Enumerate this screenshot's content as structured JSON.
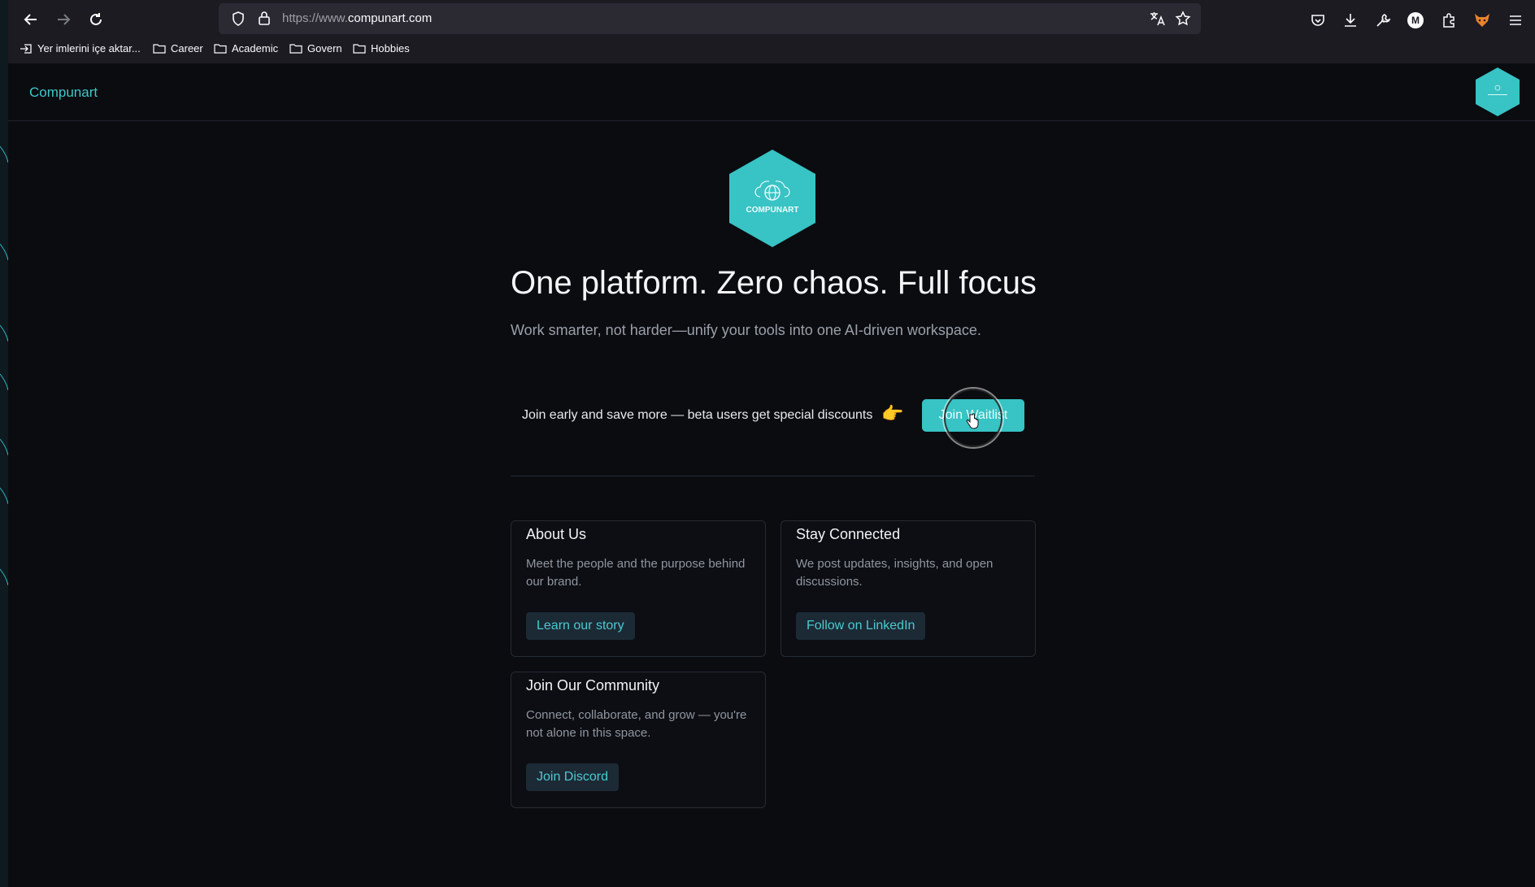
{
  "browser": {
    "url_prefix": "https://www.",
    "url_domain": "compunart.com",
    "bookmarks": [
      {
        "label": "Yer imlerini içe aktar..."
      },
      {
        "label": "Career"
      },
      {
        "label": "Academic"
      },
      {
        "label": "Govern"
      },
      {
        "label": "Hobbies"
      }
    ],
    "profile_initial": "M"
  },
  "site": {
    "brand": "Compunart",
    "logo_text": "COMPUNART",
    "accent_color": "#38c3c4"
  },
  "hero": {
    "headline": "One platform. Zero chaos. Full focus",
    "subhead": "Work smarter, not harder—unify your tools into one AI-driven workspace.",
    "cta_text": "Join early and save more — beta users get special discounts",
    "cta_emoji": "👉",
    "waitlist_button": "Join Waitlist"
  },
  "cards": [
    {
      "title": "About Us",
      "description": "Meet the people and the purpose behind our brand.",
      "button": "Learn our story"
    },
    {
      "title": "Stay Connected",
      "description": "We post updates, insights, and open discussions.",
      "button": "Follow on LinkedIn"
    },
    {
      "title": "Join Our Community",
      "description": "Connect, collaborate, and grow — you're not alone in this space.",
      "button": "Join Discord"
    }
  ]
}
